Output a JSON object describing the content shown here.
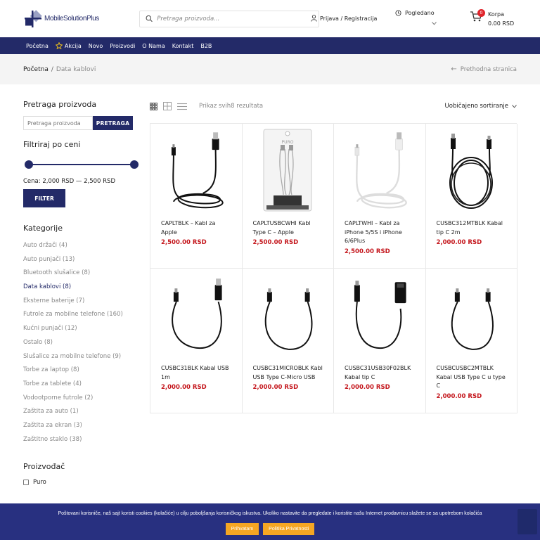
{
  "header": {
    "logo_text": "MobileSolutionPlus",
    "search_placeholder": "Pretraga proizvoda...",
    "login_label": "Prijava / Registracija",
    "viewed_label": "Pogledano",
    "cart_label": "Korpa",
    "cart_total": "0.00 RSD",
    "cart_count": "0"
  },
  "nav": {
    "items": [
      "Početna",
      "Akcija",
      "Novo",
      "Proizvodi",
      "O Nama",
      "Kontakt",
      "B2B"
    ]
  },
  "breadcrumb": {
    "home": "Početna",
    "separator": "/",
    "current": "Data kablovi",
    "back": "Prethodna stranica"
  },
  "sidebar": {
    "search_title": "Pretraga proizvoda",
    "search_placeholder": "Pretraga proizvoda",
    "search_button": "PRETRAGA",
    "filter_title": "Filtriraj po ceni",
    "price_range_text": "Cena: 2,000 RSD — 2,500 RSD",
    "filter_button": "FILTER",
    "categories_title": "Kategorije",
    "categories": [
      "Auto držači (4)",
      "Auto punjači (13)",
      "Bluetooth slušalice (8)",
      "Data kablovi (8)",
      "Eksterne baterije (7)",
      "Futrole za mobilne telefone (160)",
      "Kućni punjači (12)",
      "Ostalo (8)",
      "Slušalice za mobilne telefone (9)",
      "Torbe za laptop (8)",
      "Torbe za tablete (4)",
      "Vodootporne futrole (2)",
      "Zaštita za auto (1)",
      "Zaštita za ekran (3)",
      "Zaštitno staklo (38)"
    ],
    "active_category_index": 3,
    "manufacturer_title": "Proizvođač",
    "manufacturers": [
      "Puro"
    ]
  },
  "toolbar": {
    "result_count": "Prikaz svih8 rezultata",
    "sort_label": "Uobičajeno sortiranje"
  },
  "products": [
    {
      "name": "CAPLTBLK – Kabl za Apple",
      "price": "2,500.00 RSD",
      "image": "black-lightning-cable"
    },
    {
      "name": "CAPLTUSBCWHI Kabl Type C – Apple",
      "price": "2,500.00 RSD",
      "image": "white-cable-box"
    },
    {
      "name": "CAPLTWHI – Kabl za iPhone 5/5S i iPhone 6/6Plus",
      "price": "2,500.00 RSD",
      "image": "white-lightning-cable"
    },
    {
      "name": "CUSBC312MTBLK Kabal tip C 2m",
      "price": "2,000.00 RSD",
      "image": "black-usbc-cable-coiled"
    },
    {
      "name": "CUSBC31BLK Kabal USB 1m",
      "price": "2,000.00 RSD",
      "image": "black-usb-cable"
    },
    {
      "name": "CUSBC31MICROBLK Kabl USB Type C-Micro USB",
      "price": "2,000.00 RSD",
      "image": "black-usbc-micro-cable"
    },
    {
      "name": "CUSBC31USB30F02BLK Kabal tip C",
      "price": "2,000.00 RSD",
      "image": "black-usbc-adapter"
    },
    {
      "name": "CUSBCUSBC2MTBLK Kabal USB Type C u type C",
      "price": "2,000.00 RSD",
      "image": "black-usbc-usbc-cable"
    }
  ],
  "cookie": {
    "message": "Poštovani korisniče, naš sajt koristi cookies (kolačiće) u cilju poboljšanja korisničkog iskustva. Ukoliko nastavite da pregledate i koristite našu Internet prodavnicu slažete se sa upotrebom kolačića",
    "accept": "Prihvatam",
    "policy": "Politika Privatnosti"
  },
  "colors": {
    "brand": "#232a68",
    "price": "#c4161c",
    "cookie_button": "#f5a623",
    "badge": "#e0242b"
  }
}
